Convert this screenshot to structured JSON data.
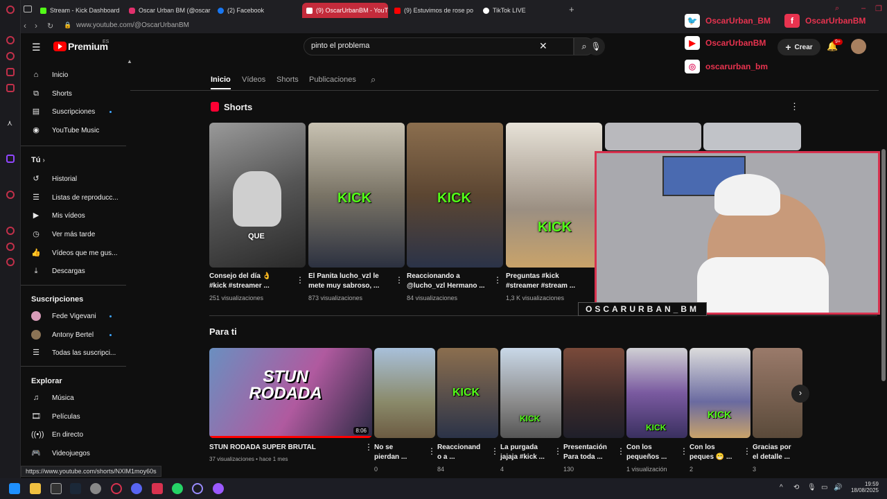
{
  "browser": {
    "tabs": [
      {
        "label": "Stream - Kick Dashboard",
        "color": "#53fc18"
      },
      {
        "label": "Oscar Urban BM (@oscar",
        "color": "#e1306c"
      },
      {
        "label": "(2) Facebook",
        "color": "#1877f2"
      },
      {
        "label": "(9) OscarUrbanBM - YouT",
        "color": "#ff0000",
        "active": true
      },
      {
        "label": "(9) Estuvimos de rose po",
        "color": "#ff0000"
      },
      {
        "label": "TikTok LIVE",
        "color": "#ffffff"
      }
    ],
    "url": "www.youtube.com/@OscarUrbanBM",
    "status_url": "https://www.youtube.com/shorts/NXIM1moy60s"
  },
  "youtube": {
    "logo": "Premium",
    "region": "ES",
    "search_value": "pinto el problema",
    "create_label": "Crear",
    "notif_count": "9+"
  },
  "sidebar": {
    "main": [
      {
        "label": "Inicio",
        "icon": "home-icon"
      },
      {
        "label": "Shorts",
        "icon": "shorts-icon"
      },
      {
        "label": "Suscripciones",
        "icon": "subscriptions-icon"
      },
      {
        "label": "YouTube Music",
        "icon": "music-icon"
      }
    ],
    "you_title": "Tú",
    "you": [
      {
        "label": "Historial",
        "icon": "history-icon"
      },
      {
        "label": "Listas de reproducc...",
        "icon": "playlist-icon"
      },
      {
        "label": "Mis vídeos",
        "icon": "video-icon"
      },
      {
        "label": "Ver más tarde",
        "icon": "clock-icon"
      },
      {
        "label": "Vídeos que me gus...",
        "icon": "like-icon"
      },
      {
        "label": "Descargas",
        "icon": "download-icon"
      }
    ],
    "subs_title": "Suscripciones",
    "subs": [
      {
        "label": "Fede Vigevani"
      },
      {
        "label": "Antony Bertel"
      },
      {
        "label": "Todas las suscripci..."
      }
    ],
    "explore_title": "Explorar",
    "explore": [
      {
        "label": "Música",
        "icon": "music-note-icon"
      },
      {
        "label": "Películas",
        "icon": "film-icon"
      },
      {
        "label": "En directo",
        "icon": "live-icon"
      },
      {
        "label": "Videojuegos",
        "icon": "gamepad-icon"
      }
    ]
  },
  "channel_tabs": [
    "Inicio",
    "Vídeos",
    "Shorts",
    "Publicaciones"
  ],
  "shorts": {
    "title": "Shorts",
    "items": [
      {
        "title1": "Consejo del día 👌",
        "title2": "#kick #streamer ...",
        "views": "251 visualizaciones"
      },
      {
        "title1": "El Panita lucho_vzl le",
        "title2": "mete muy sabroso, ...",
        "views": "873 visualizaciones"
      },
      {
        "title1": "Reaccionando a",
        "title2": "@lucho_vzl Hermano ...",
        "views": "84 visualizaciones"
      },
      {
        "title1": "Preguntas #kick",
        "title2": "#streamer #stream ...",
        "views": "1,3 K visualizaciones"
      }
    ]
  },
  "para_ti": {
    "title": "Para ti",
    "main": {
      "title": "STUN RODADA SUPER BRUTAL",
      "meta": "37 visualizaciones • hace 1 mes",
      "duration": "8:06",
      "thumb_text": "STUN RODADA"
    },
    "items": [
      {
        "t1": "No se",
        "t2": "pierdan ...",
        "v": "0"
      },
      {
        "t1": "Reaccionand",
        "t2": "o a ...",
        "v": "84"
      },
      {
        "t1": "La purgada",
        "t2": "jajaja #kick ...",
        "v": "4"
      },
      {
        "t1": "Presentación",
        "t2": "Para toda ...",
        "v": "130"
      },
      {
        "t1": "Con los",
        "t2": "pequeños ...",
        "v": "1 visualización"
      },
      {
        "t1": "Con los",
        "t2": "peques 😁 ...",
        "v": "2"
      },
      {
        "t1": "Gracias por",
        "t2": "el detalle ...",
        "v": "3"
      }
    ]
  },
  "overlay": {
    "twitter": "OscarUrban_BM",
    "facebook": "OscarUrbanBM",
    "youtube": "OscarUrbanBM",
    "instagram": "oscarurban_bm",
    "name_plate": "OSCARURBAN_BM",
    "kick_text": "KICK",
    "que_text": "QUE",
    "border_color": "#d8324f"
  },
  "taskbar": {
    "time": "19:59",
    "date": "18/08/2025"
  }
}
